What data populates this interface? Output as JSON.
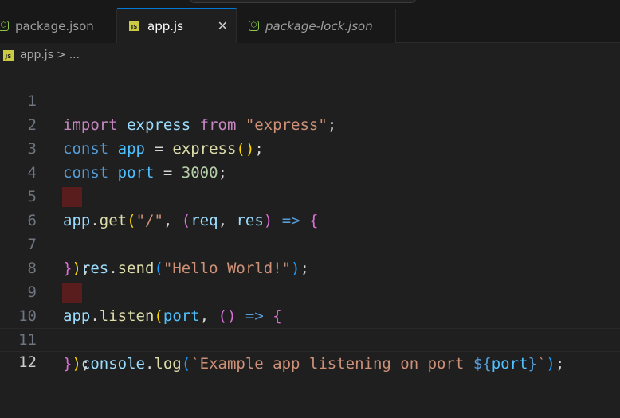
{
  "tabs": [
    {
      "label": "package.json",
      "active": false,
      "italic": false,
      "icon": "node-icon"
    },
    {
      "label": "app.js",
      "active": true,
      "italic": false,
      "icon": "js-icon"
    },
    {
      "label": "package-lock.json",
      "active": false,
      "italic": true,
      "icon": "node-icon"
    }
  ],
  "icons": {
    "js_text": "JS",
    "node_glyph": "⬡",
    "close_glyph": "✕"
  },
  "breadcrumb": {
    "file": "app.js",
    "separator": ">",
    "more": "..."
  },
  "editor": {
    "current_line": 12,
    "lines": [
      {
        "n": "1",
        "code": "import express from \"express\";"
      },
      {
        "n": "2",
        "code": "const app = express();"
      },
      {
        "n": "3",
        "code": "const port = 3000;"
      },
      {
        "n": "4",
        "code": ""
      },
      {
        "n": "5",
        "code": "app.get(\"/\", (req, res) => {"
      },
      {
        "n": "6",
        "code": "  res.send(\"Hello World!\");"
      },
      {
        "n": "7",
        "code": "});"
      },
      {
        "n": "8",
        "code": ""
      },
      {
        "n": "9",
        "code": "app.listen(port, () => {"
      },
      {
        "n": "10",
        "code": "  console.log(`Example app listening on port ${port}`);"
      },
      {
        "n": "11",
        "code": "});"
      },
      {
        "n": "12",
        "code": ""
      }
    ]
  },
  "colors": {
    "background": "#1f1f1f",
    "tabbar": "#181818",
    "active_tab_accent": "#0078d4",
    "keyword": "#569cd6",
    "control_keyword": "#c586c0",
    "variable": "#9cdcfe",
    "function": "#dcdcaa",
    "string": "#ce9178",
    "number": "#b5cea8",
    "indent_error": "#5a1d1d"
  }
}
